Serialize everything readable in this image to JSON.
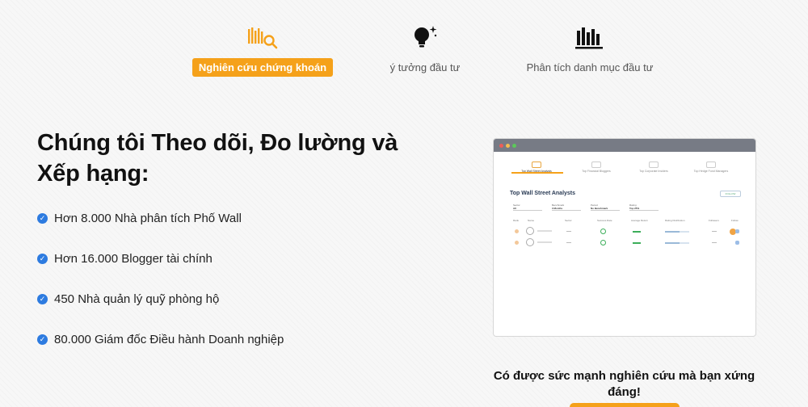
{
  "tabs": [
    {
      "label": "Nghiên cứu chứng khoán",
      "icon": "stock-research-icon",
      "active": true
    },
    {
      "label": "ý tưởng đầu tư",
      "icon": "lightbulb-icon",
      "active": false
    },
    {
      "label": "Phân tích danh mục đầu tư",
      "icon": "bar-chart-icon",
      "active": false
    }
  ],
  "headline": "Chúng tôi Theo dõi, Đo lường và Xếp hạng:",
  "stats": [
    "Hơn 8.000 Nhà phân tích Phố Wall",
    "Hơn 16.000 Blogger tài chính",
    "450 Nhà quản lý quỹ phòng hộ",
    "80.000 Giám đốc Điều hành Doanh nghiệp"
  ],
  "preview": {
    "tabs": [
      "Top Wall Street Analysts",
      "Top Financial Bloggers",
      "Top Corporate Insiders",
      "Top Hedge Fund Managers"
    ],
    "title": "Top Wall Street Analysts",
    "follow": "FOLLOW",
    "filters": [
      {
        "label": "Sector",
        "value": "All"
      },
      {
        "label": "Benchmark",
        "value": "3 Months"
      },
      {
        "label": "Period",
        "value": "No Benchmark"
      },
      {
        "label": "Rating",
        "value": "Top 25%"
      }
    ],
    "columns": [
      "Rank",
      "Name",
      "Sector",
      "Success Rate",
      "Average Return",
      "Rating Distribution",
      "Followers",
      "Follow"
    ]
  },
  "cta": {
    "text": "Có được sức mạnh nghiên cứu mà bạn xứng đáng!"
  },
  "colors": {
    "accent": "#f5a11a",
    "check": "#2d7be0",
    "text": "#111111"
  }
}
